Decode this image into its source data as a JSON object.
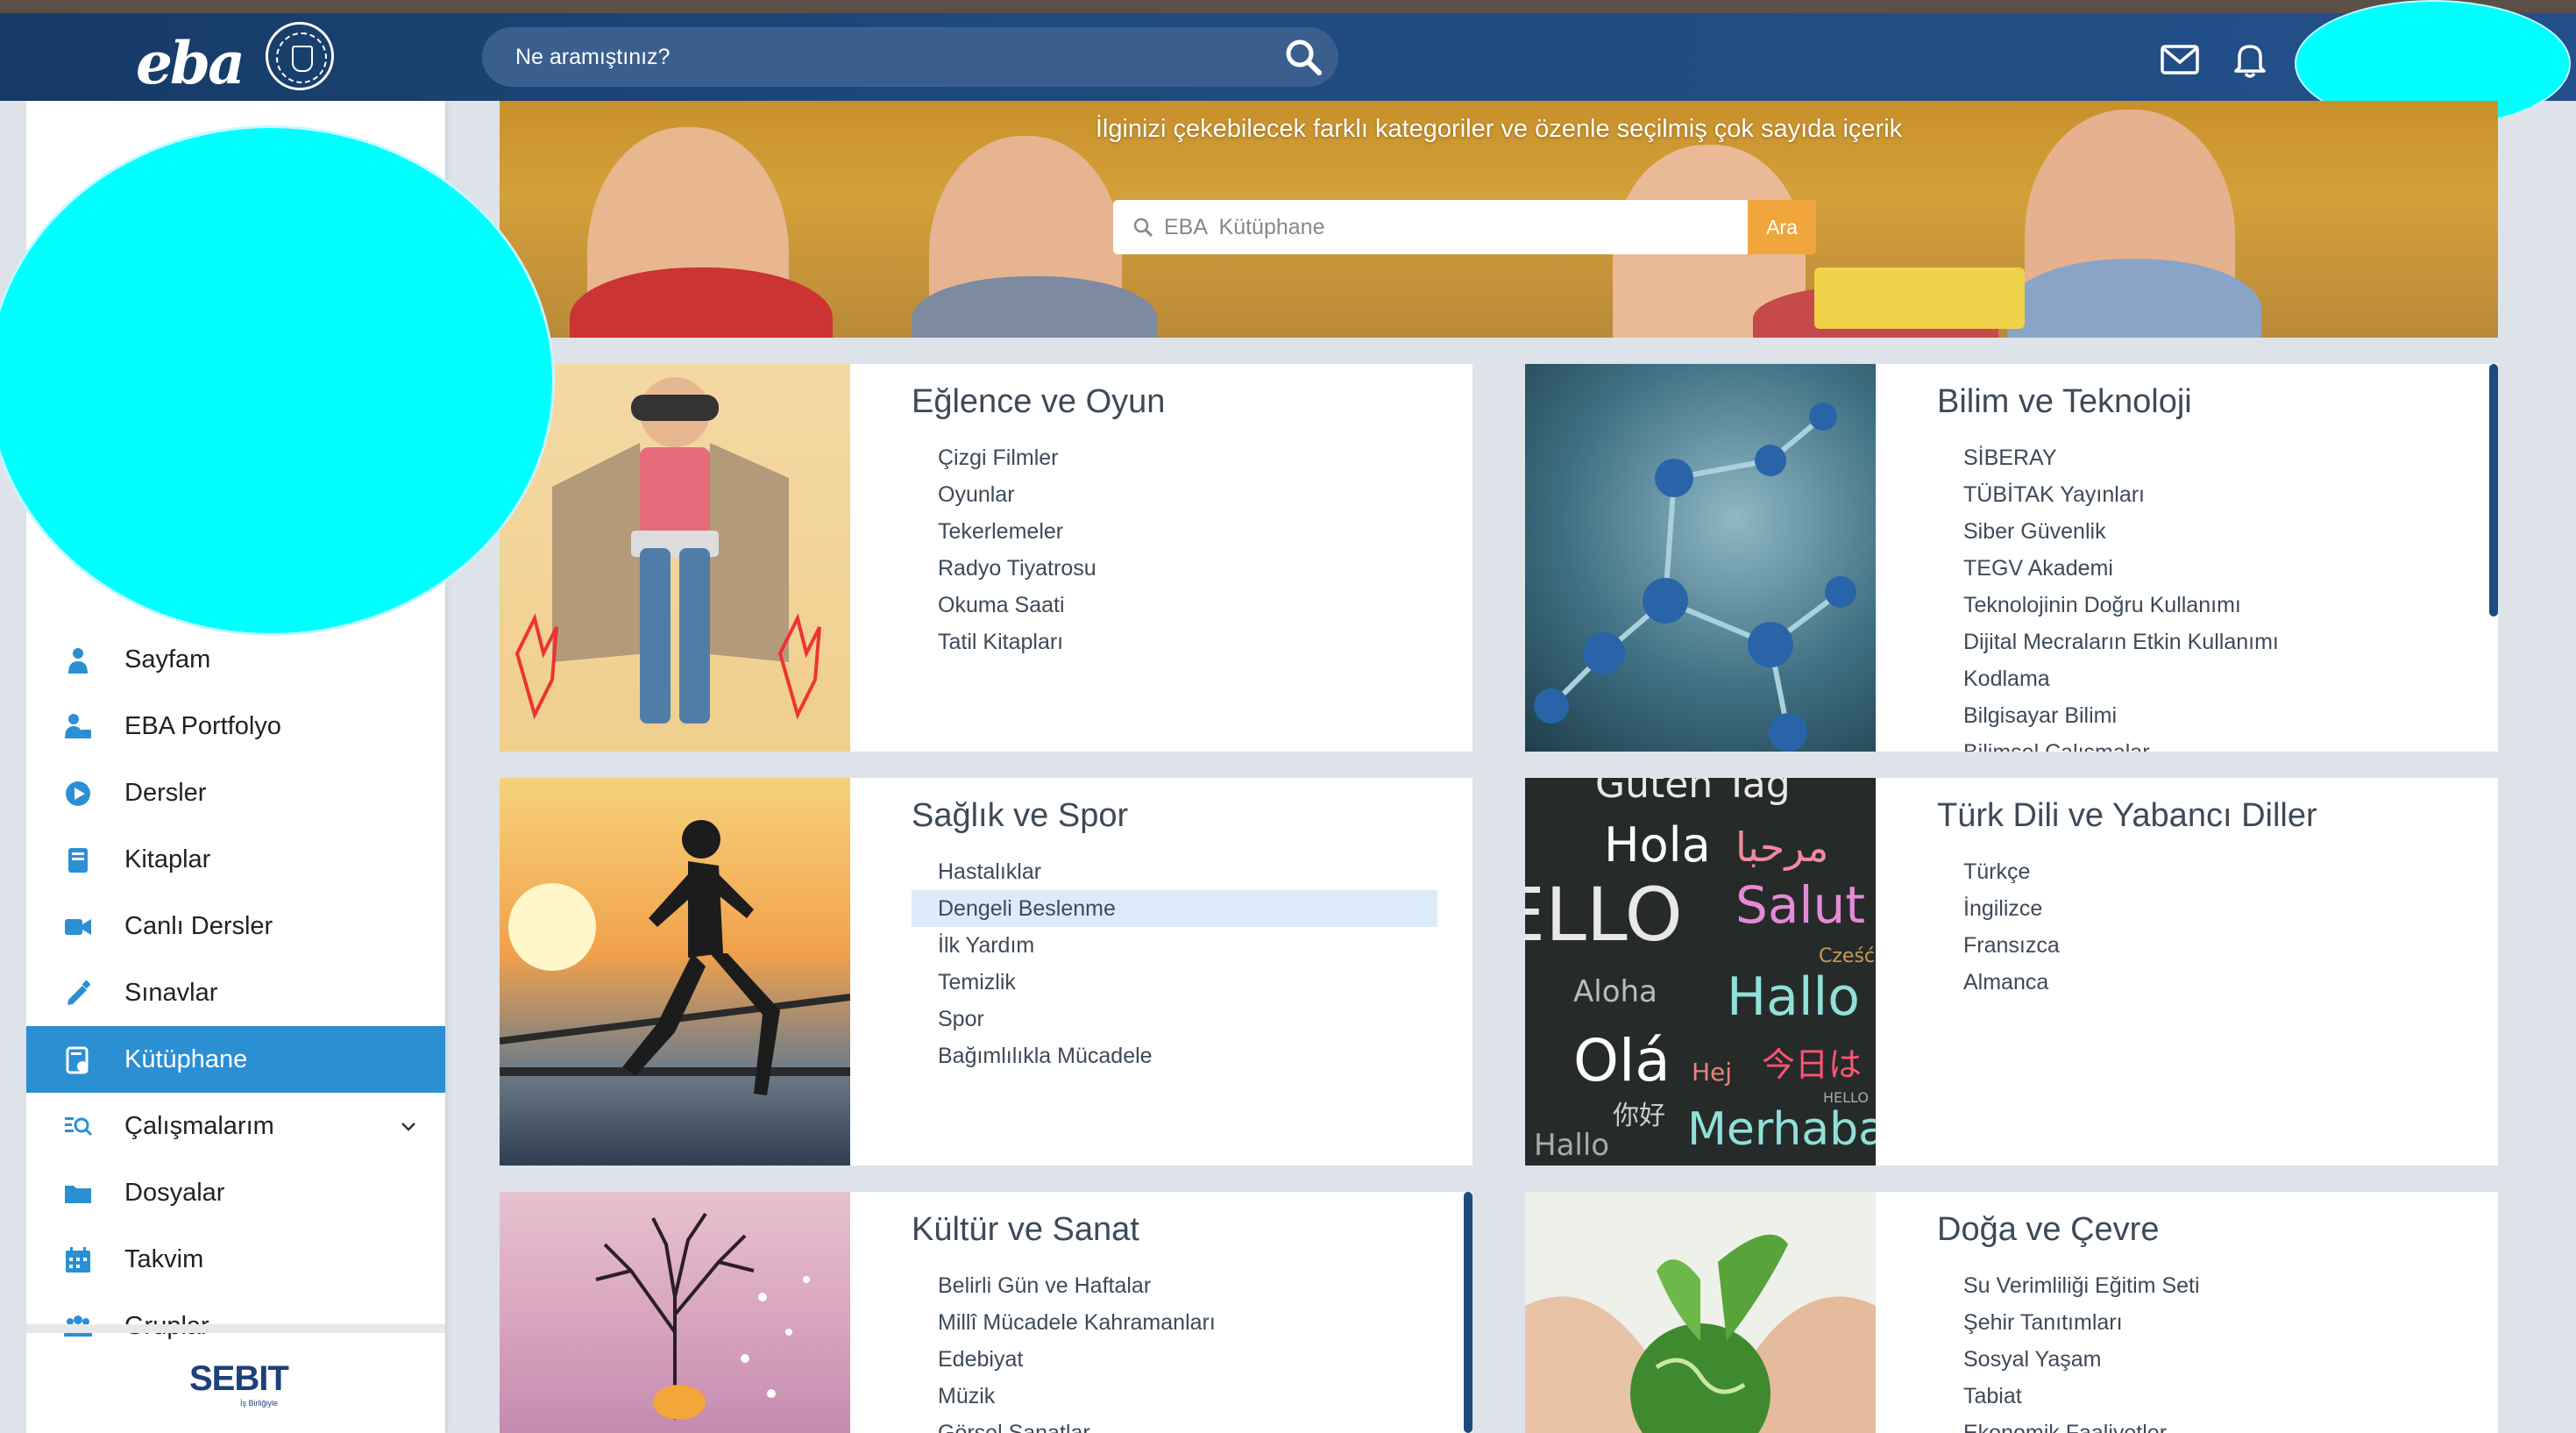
{
  "header": {
    "logo": "eba",
    "search_placeholder": "Ne aramıştınız?"
  },
  "sidebar": {
    "items": [
      {
        "label": "Sayfam",
        "icon": "user-icon"
      },
      {
        "label": "EBA Portfolyo",
        "icon": "portfolio-icon"
      },
      {
        "label": "Dersler",
        "icon": "play-icon"
      },
      {
        "label": "Kitaplar",
        "icon": "book-icon"
      },
      {
        "label": "Canlı Dersler",
        "icon": "video-icon"
      },
      {
        "label": "Sınavlar",
        "icon": "pencil-icon"
      },
      {
        "label": "Kütüphane",
        "icon": "library-icon"
      },
      {
        "label": "Çalışmalarım",
        "icon": "search-list-icon"
      },
      {
        "label": "Dosyalar",
        "icon": "folder-icon"
      },
      {
        "label": "Takvim",
        "icon": "calendar-icon"
      },
      {
        "label": "Gruplar",
        "icon": "users-icon"
      }
    ],
    "active_label": "Kütüphane",
    "footer_logo": "SEBIT",
    "footer_sub": "İş Birliğiyle"
  },
  "banner": {
    "text": "İlginizi çekebilecek farklı kategoriler ve özenle seçilmiş çok sayıda içerik",
    "search_placeholder": "EBA  Kütüphane",
    "search_button": "Ara"
  },
  "categories": [
    {
      "title": "Eğlence ve Oyun",
      "items": [
        "Çizgi Filmler",
        "Oyunlar",
        "Tekerlemeler",
        "Radyo Tiyatrosu",
        "Okuma Saati",
        "Tatil Kitapları"
      ]
    },
    {
      "title": "Bilim ve Teknoloji",
      "items": [
        "SİBERAY",
        "TÜBİTAK Yayınları",
        "Siber Güvenlik",
        "TEGV Akademi",
        "Teknolojinin Doğru Kullanımı",
        "Dijital Mecraların Etkin Kullanımı",
        "Kodlama",
        "Bilgisayar Bilimi",
        "Bilimsel Çalışmalar"
      ]
    },
    {
      "title": "Sağlık ve Spor",
      "items": [
        "Hastalıklar",
        "Dengeli Beslenme",
        "İlk Yardım",
        "Temizlik",
        "Spor",
        "Bağımlılıkla Mücadele"
      ]
    },
    {
      "title": "Türk Dili ve Yabancı Diller",
      "items": [
        "Türkçe",
        "İngilizce",
        "Fransızca",
        "Almanca"
      ]
    },
    {
      "title": "Kültür ve Sanat",
      "items": [
        "Belirli Gün ve Haftalar",
        "Millî Mücadele Kahramanları",
        "Edebiyat",
        "Müzik",
        "Görsel Sanatlar"
      ]
    },
    {
      "title": "Doğa ve Çevre",
      "items": [
        "Su Verimliliği Eğitim Seti",
        "Şehir Tanıtımları",
        "Sosyal Yaşam",
        "Tabiat",
        "Ekonomik Faaliyetler"
      ]
    }
  ],
  "languages_image_words": [
    "Guten Tag",
    "Hola",
    "مرحبا",
    "Salut",
    "ELLO",
    "Cześć",
    "Aloha",
    "Hallo",
    "Olá",
    "Hej",
    "今日は",
    "HELLO",
    "你好",
    "Merhaba"
  ],
  "colors": {
    "accent": "#2b8fd4",
    "header": "#1f4a7d",
    "ara_button": "#f0a63c",
    "highlight": "#dcebfa"
  }
}
